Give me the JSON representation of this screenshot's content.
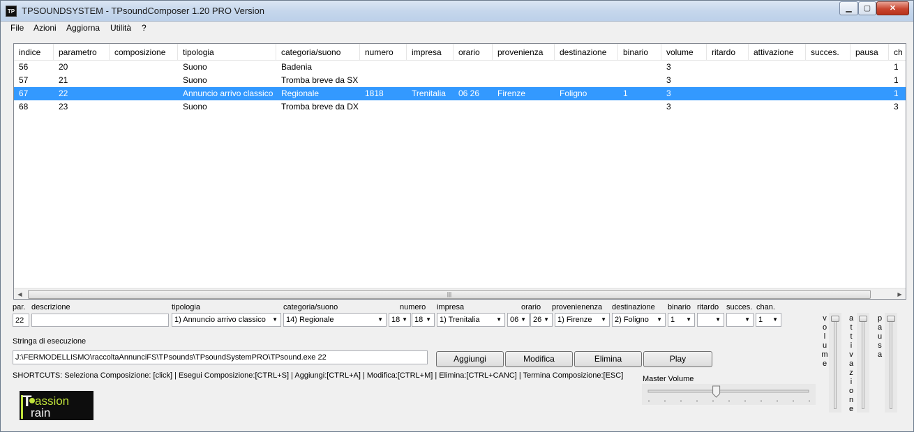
{
  "window": {
    "title": "TPSOUNDSYSTEM - TPsoundComposer 1.20 PRO Version",
    "icon_label": "TP"
  },
  "menu": [
    "File",
    "Azioni",
    "Aggiorna",
    "Utilità",
    "?"
  ],
  "table": {
    "columns": [
      "indice",
      "parametro",
      "composizione",
      "tipologia",
      "categoria/suono",
      "numero",
      "impresa",
      "orario",
      "provenienza",
      "destinazione",
      "binario",
      "volume",
      "ritardo",
      "attivazione",
      "succes.",
      "pausa",
      "ch"
    ],
    "rows": [
      [
        "56",
        "20",
        "",
        "Suono",
        "Badenia",
        "",
        "",
        "",
        "",
        "",
        "",
        "3",
        "",
        "",
        "",
        "",
        "1"
      ],
      [
        "57",
        "21",
        "",
        "Suono",
        "Tromba breve da SX",
        "",
        "",
        "",
        "",
        "",
        "",
        "3",
        "",
        "",
        "",
        "",
        "1"
      ],
      [
        "67",
        "22",
        "",
        "Annuncio arrivo classico",
        "Regionale",
        "1818",
        "Trenitalia",
        "06 26",
        "Firenze",
        "Foligno",
        "1",
        "3",
        "",
        "",
        "",
        "",
        "1"
      ],
      [
        "68",
        "23",
        "",
        "Suono",
        "Tromba breve da DX",
        "",
        "",
        "",
        "",
        "",
        "",
        "3",
        "",
        "",
        "",
        "",
        "3"
      ]
    ],
    "selected_row": 2
  },
  "form": {
    "labels": {
      "par": "par.",
      "descrizione": "descrizione",
      "tipologia": "tipologia",
      "categoria": "categoria/suono",
      "numero": "numero",
      "impresa": "impresa",
      "orario": "orario",
      "provenienza": "provenienenza",
      "destinazione": "destinazione",
      "binario": "binario",
      "ritardo": "ritardo",
      "succes": "succes.",
      "chan": "chan."
    },
    "values": {
      "par": "22",
      "descrizione": "",
      "tipologia": "1) Annuncio arrivo classico",
      "categoria": "14) Regionale",
      "numero1": "18",
      "numero2": "18",
      "impresa": "1) Trenitalia",
      "orario_h": "06",
      "orario_m": "26",
      "provenienza": "1) Firenze",
      "destinazione": "2) Foligno",
      "binario": "1",
      "ritardo": "",
      "succes": "",
      "chan": "1"
    },
    "exec_label": "Stringa di esecuzione",
    "exec_value": "J:\\FERMODELLISMO\\raccoltaAnnunciFS\\TPsounds\\TPsoundSystemPRO\\TPsound.exe 22",
    "buttons": {
      "aggiungi": "Aggiungi",
      "modifica": "Modifica",
      "elimina": "Elimina",
      "play": "Play"
    },
    "shortcuts": "SHORTCUTS: Seleziona Composizione: [click] | Esegui Composizione:[CTRL+S] | Aggiungi:[CTRL+A] | Modifica:[CTRL+M] | Elimina:[CTRL+CANC] | Termina Composizione:[ESC]",
    "master_volume_label": "Master Volume",
    "master_volume_level": 0.42
  },
  "sliders": {
    "volume": "volume",
    "attivazione": "attivazione",
    "pausa": "pausa"
  },
  "logo": {
    "line1": "assion",
    "line2": "rain"
  }
}
